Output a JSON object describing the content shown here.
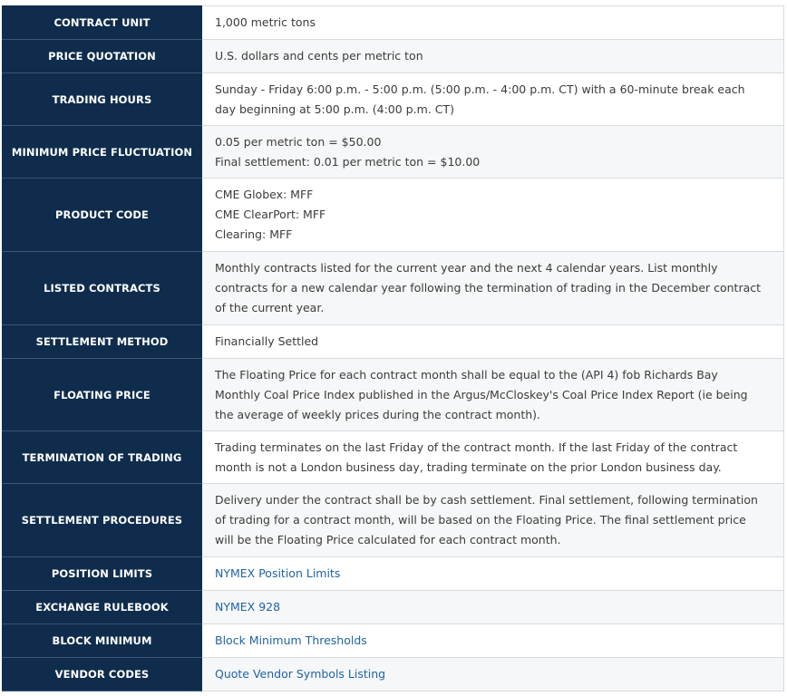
{
  "rows": [
    {
      "label": "CONTRACT UNIT",
      "lines": [
        "1,000 metric tons"
      ]
    },
    {
      "label": "PRICE QUOTATION",
      "lines": [
        "U.S. dollars and cents per metric ton"
      ]
    },
    {
      "label": "TRADING HOURS",
      "lines": [
        "Sunday - Friday 6:00 p.m. - 5:00 p.m. (5:00 p.m. - 4:00 p.m. CT) with a 60-minute break each",
        "day beginning at 5:00 p.m. (4:00 p.m. CT)"
      ]
    },
    {
      "label": "MINIMUM PRICE FLUCTUATION",
      "lines": [
        "0.05 per metric ton = $50.00",
        "Final settlement: 0.01 per metric ton = $10.00"
      ]
    },
    {
      "label": "PRODUCT CODE",
      "lines": [
        "CME Globex: MFF",
        "CME ClearPort: MFF",
        "Clearing: MFF"
      ]
    },
    {
      "label": "LISTED CONTRACTS",
      "lines": [
        "Monthly contracts listed for the current year and the next 4 calendar years. List monthly",
        "contracts for a new calendar year following the termination of trading in the December contract",
        "of the current year."
      ]
    },
    {
      "label": "SETTLEMENT METHOD",
      "lines": [
        "Financially Settled"
      ]
    },
    {
      "label": "FLOATING PRICE",
      "lines": [
        "The Floating Price for each contract month shall be equal to the (API 4) fob Richards Bay",
        "Monthly Coal Price Index published in the Argus/McCloskey's Coal Price Index Report (ie being",
        "the average of weekly prices during the contract month)."
      ]
    },
    {
      "label": "TERMINATION OF TRADING",
      "lines": [
        "Trading terminates on the last Friday of the contract month. If the last Friday of the contract",
        "month is not a  London business day, trading terminate on the prior London business day."
      ]
    },
    {
      "label": "SETTLEMENT PROCEDURES",
      "lines": [
        "Delivery under the contract shall be by cash settlement. Final settlement, following termination",
        "of trading for a contract month, will be based on the Floating Price. The final settlement price",
        "will be the Floating Price calculated for each contract month."
      ]
    },
    {
      "label": "POSITION LIMITS",
      "link": "NYMEX Position Limits"
    },
    {
      "label": "EXCHANGE RULEBOOK",
      "link": "NYMEX 928"
    },
    {
      "label": "BLOCK MINIMUM",
      "link": "Block Minimum Thresholds"
    },
    {
      "label": "VENDOR CODES",
      "link": "Quote Vendor Symbols Listing"
    }
  ],
  "colors": {
    "label_bg": "#0f2c4c",
    "label_text": "#ffffff",
    "value_text": "#3b3b3b",
    "link": "#1e63a6"
  }
}
